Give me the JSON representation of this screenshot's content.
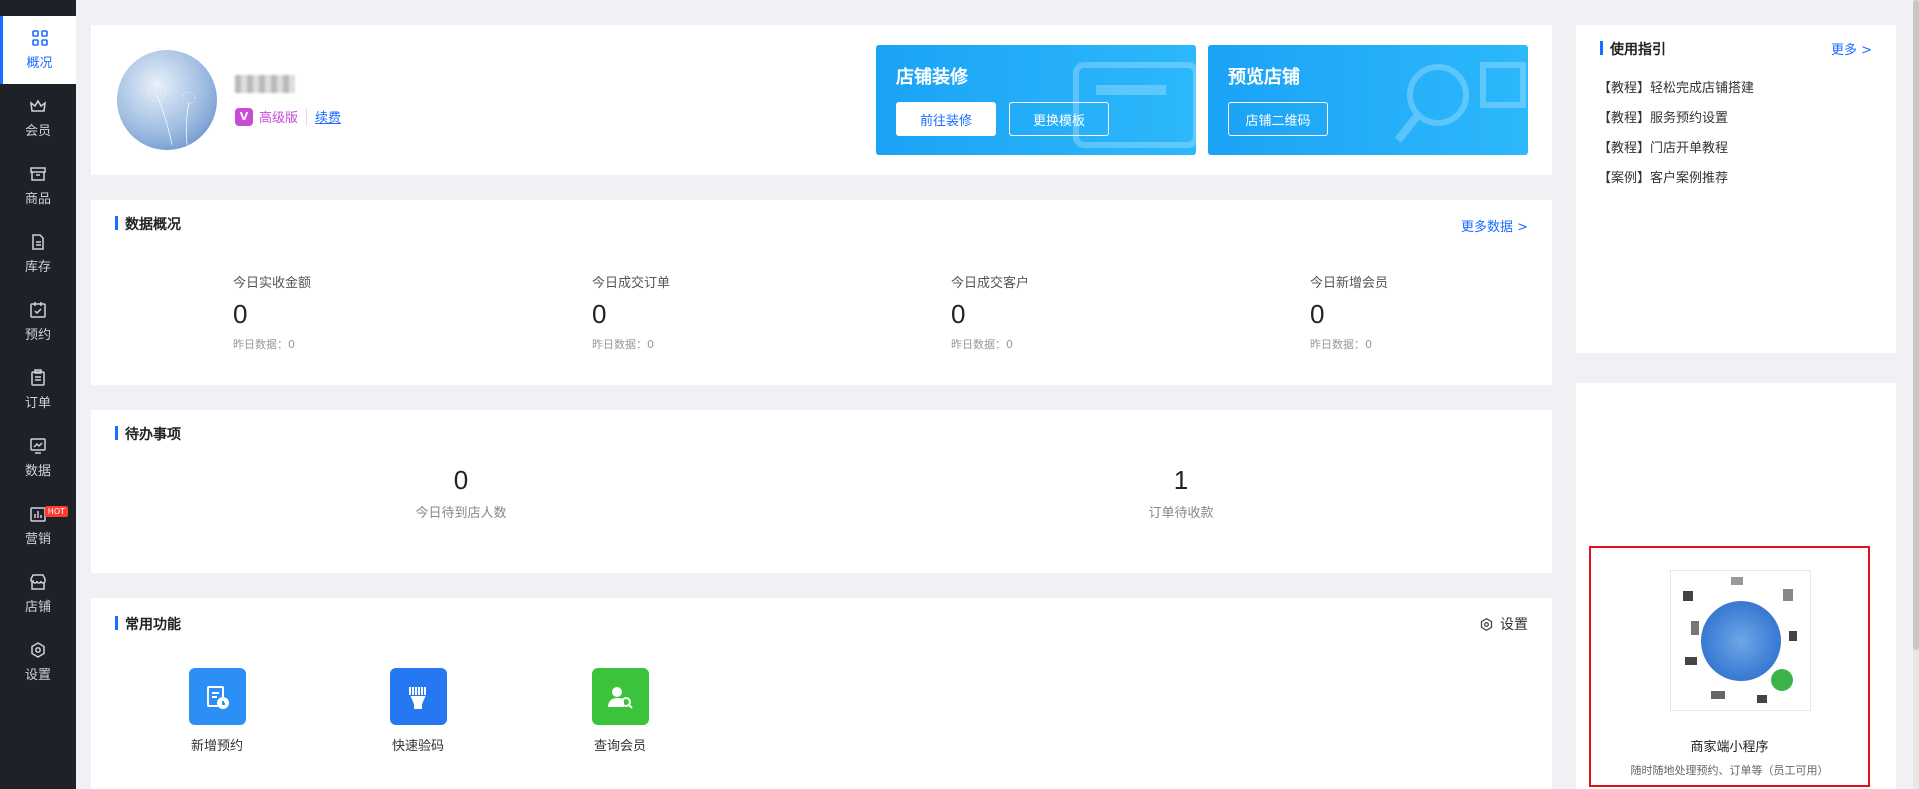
{
  "sidebar": {
    "items": [
      {
        "label": "概况",
        "icon": "grid-icon",
        "active": true
      },
      {
        "label": "会员",
        "icon": "crown-icon"
      },
      {
        "label": "商品",
        "icon": "box-icon"
      },
      {
        "label": "库存",
        "icon": "inventory-icon"
      },
      {
        "label": "预约",
        "icon": "calendar-check-icon"
      },
      {
        "label": "订单",
        "icon": "clipboard-icon"
      },
      {
        "label": "数据",
        "icon": "chart-icon"
      },
      {
        "label": "营销",
        "icon": "marketing-icon",
        "badge": "HOT"
      },
      {
        "label": "店铺",
        "icon": "store-icon"
      },
      {
        "label": "设置",
        "icon": "gear-icon"
      }
    ]
  },
  "store": {
    "edition": "高级版",
    "renew": "续费"
  },
  "promo": {
    "decorate": {
      "title": "店铺装修",
      "btn1": "前往装修",
      "btn2": "更换模板"
    },
    "preview": {
      "title": "预览店铺",
      "btn1": "店铺二维码"
    }
  },
  "overview": {
    "title": "数据概况",
    "more": "更多数据 >",
    "stats": [
      {
        "label": "今日实收金额",
        "value": "0",
        "yesterday": "昨日数据：0"
      },
      {
        "label": "今日成交订单",
        "value": "0",
        "yesterday": "昨日数据：0"
      },
      {
        "label": "今日成交客户",
        "value": "0",
        "yesterday": "昨日数据：0"
      },
      {
        "label": "今日新增会员",
        "value": "0",
        "yesterday": "昨日数据：0"
      }
    ]
  },
  "todo": {
    "title": "待办事项",
    "items": [
      {
        "value": "0",
        "label": "今日待到店人数"
      },
      {
        "value": "1",
        "label": "订单待收款"
      }
    ]
  },
  "functions": {
    "title": "常用功能",
    "settings": "设置",
    "items": [
      {
        "label": "新增预约",
        "color": "#2b8ff5",
        "icon": "add-appointment-icon"
      },
      {
        "label": "快速验码",
        "color": "#2577f2",
        "icon": "scan-code-icon"
      },
      {
        "label": "查询会员",
        "color": "#3cc33c",
        "icon": "search-member-icon"
      }
    ]
  },
  "guide": {
    "title": "使用指引",
    "more": "更多 >",
    "items": [
      "【教程】轻松完成店铺搭建",
      "【教程】服务预约设置",
      "【教程】门店开单教程",
      "【案例】客户案例推荐"
    ]
  },
  "mini_program": {
    "title": "商家端小程序",
    "subtitle": "随时随地处理预约、订单等（员工可用）"
  },
  "colors": {
    "accent": "#1a6dff",
    "sidebar_bg": "#1f2129",
    "highlight_border": "#e0101e"
  }
}
